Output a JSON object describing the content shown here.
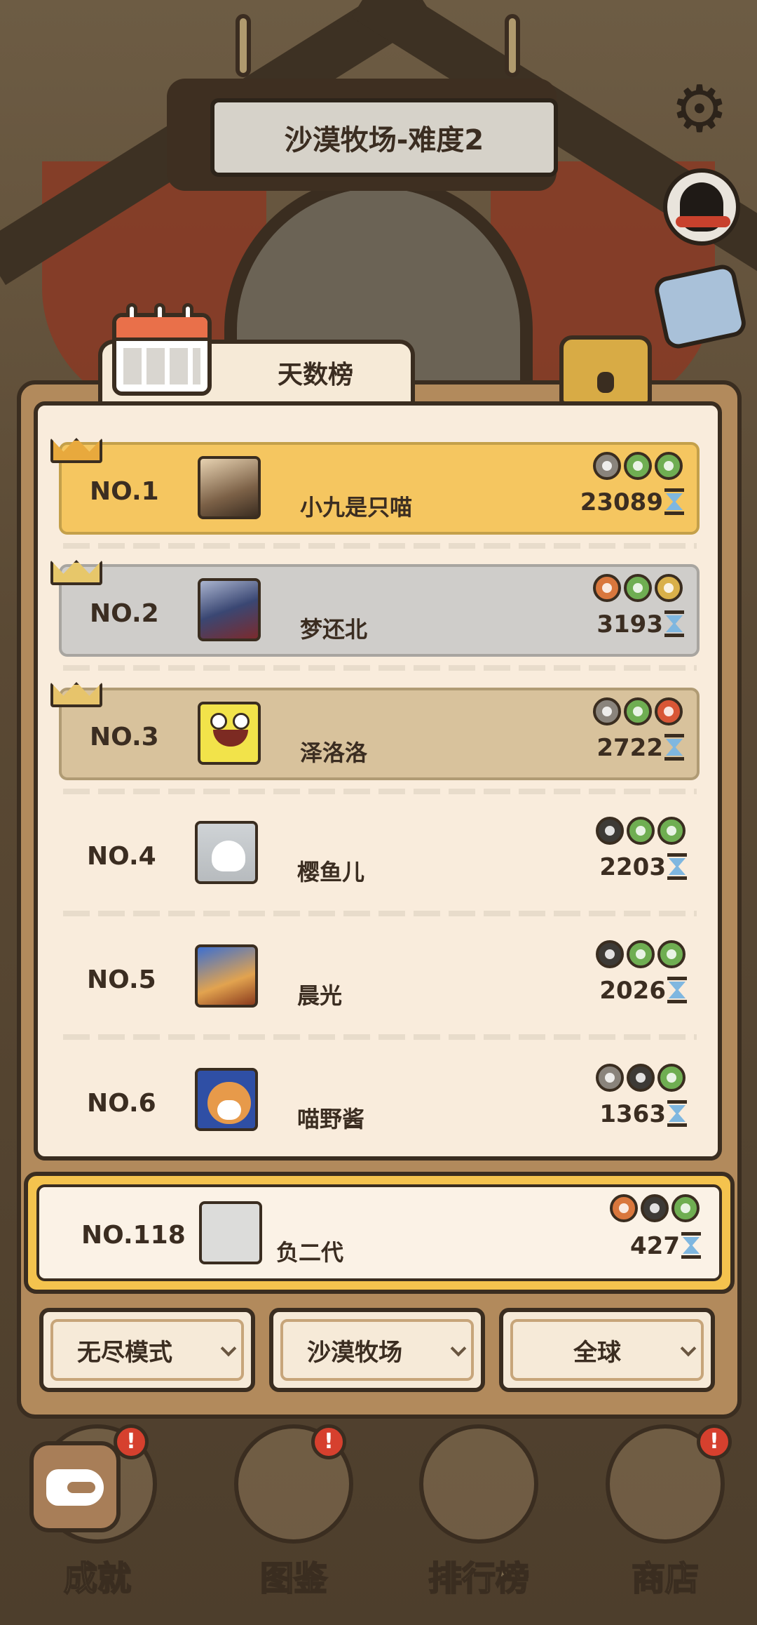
{
  "header": {
    "level_title": "沙漠牧场-难度2"
  },
  "tab": {
    "title": "天数榜"
  },
  "leaderboard": [
    {
      "rank": "NO.1",
      "name": "小九是只喵",
      "score": "23089",
      "badges": [
        "b-grey",
        "b-green",
        "b-green"
      ]
    },
    {
      "rank": "NO.2",
      "name": "梦还北",
      "score": "3193",
      "badges": [
        "b-orange",
        "b-green",
        "b-gold"
      ]
    },
    {
      "rank": "NO.3",
      "name": "泽洛洛",
      "score": "2722",
      "badges": [
        "b-grey",
        "b-green",
        "b-red"
      ]
    },
    {
      "rank": "NO.4",
      "name": "樱鱼儿",
      "score": "2203",
      "badges": [
        "b-dark",
        "b-green",
        "b-green"
      ]
    },
    {
      "rank": "NO.5",
      "name": "晨光",
      "score": "2026",
      "badges": [
        "b-dark",
        "b-green",
        "b-green"
      ]
    },
    {
      "rank": "NO.6",
      "name": "喵野酱",
      "score": "1363",
      "badges": [
        "b-grey",
        "b-dark",
        "b-green"
      ]
    }
  ],
  "player": {
    "rank": "NO.118",
    "name": "负二代",
    "score": "427",
    "badges": [
      "b-orange",
      "b-dark",
      "b-green"
    ]
  },
  "filters": [
    {
      "label": "无尽模式"
    },
    {
      "label": "沙漠牧场"
    },
    {
      "label": "全球"
    }
  ],
  "nav": [
    {
      "label": "成就",
      "icon": "coffee-cup-icon",
      "alert": "!"
    },
    {
      "label": "图鉴",
      "icon": "paw-book-icon",
      "alert": "!"
    },
    {
      "label": "排行榜",
      "icon": "scroll-icon",
      "alert": ""
    },
    {
      "label": "商店",
      "icon": "shop-icon",
      "alert": "!"
    }
  ],
  "colors": {
    "gold_row": "#f5c660",
    "silver_row": "#cfcdca",
    "bronze_row": "#d8c29c",
    "accent": "#f4c34e"
  }
}
